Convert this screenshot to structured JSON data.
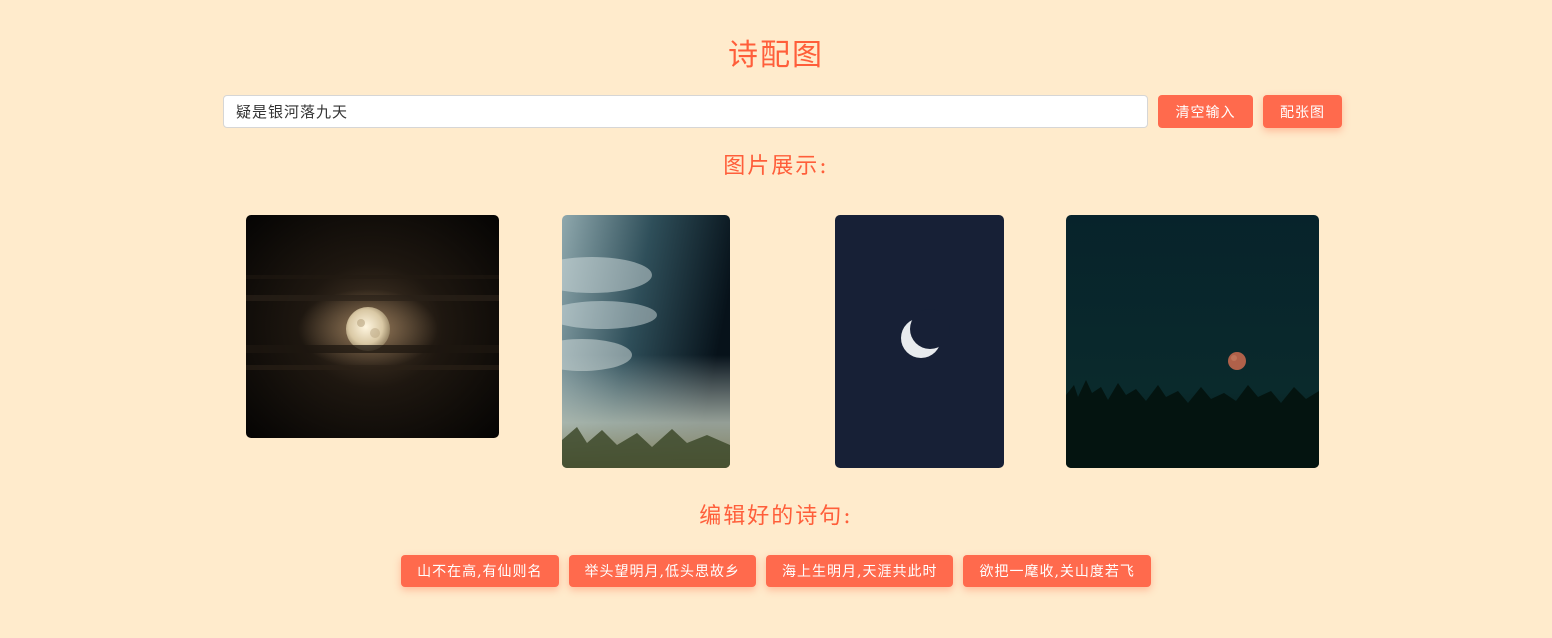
{
  "header": {
    "title": "诗配图"
  },
  "search": {
    "value": "疑是银河落九天",
    "clear_label": "清空输入",
    "match_label": "配张图"
  },
  "gallery": {
    "title": "图片展示:",
    "images": [
      {
        "subject": "full moon behind dark clouds"
      },
      {
        "subject": "misty sky over forest"
      },
      {
        "subject": "crescent moon on navy sky"
      },
      {
        "subject": "red moon over grass silhouette"
      }
    ]
  },
  "poems": {
    "title": "编辑好的诗句:",
    "items": [
      "山不在高,有仙则名",
      "举头望明月,低头思故乡",
      "海上生明月,天涯共此时",
      "欲把一麾收,关山度若飞"
    ]
  },
  "colors": {
    "background": "#ffebcc",
    "accent": "#ff5e3a",
    "button": "#ff6a4d"
  }
}
